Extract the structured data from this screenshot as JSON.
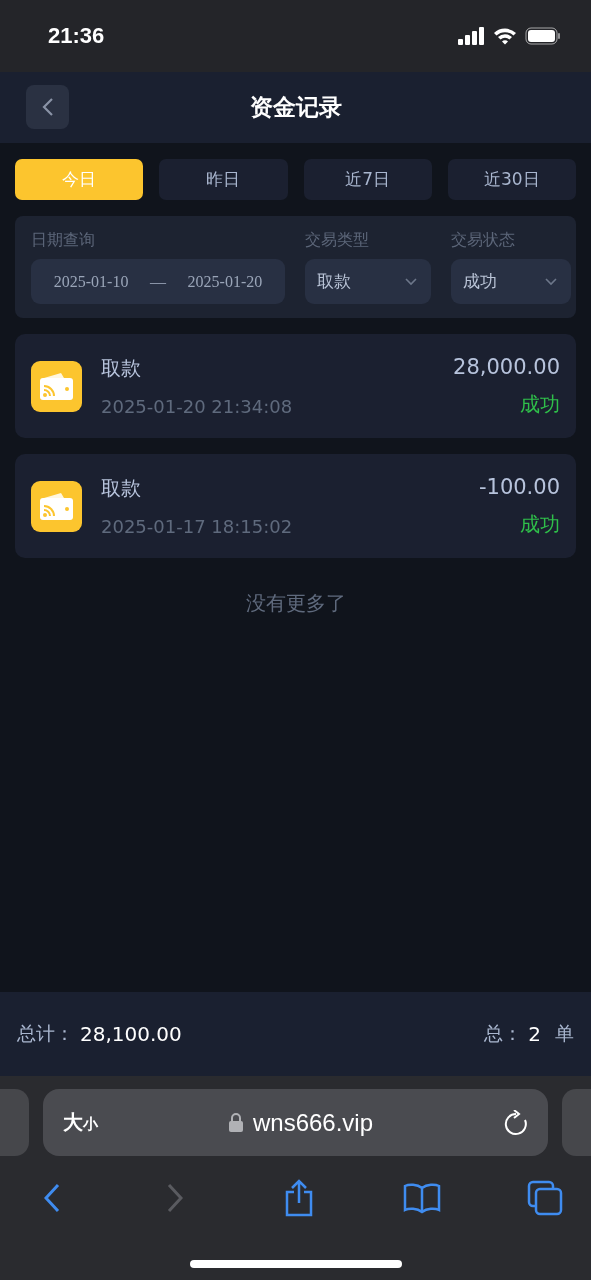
{
  "status_bar": {
    "time": "21:36"
  },
  "header": {
    "title": "资金记录"
  },
  "tabs": [
    {
      "label": "今日",
      "selected": true
    },
    {
      "label": "昨日",
      "selected": false
    },
    {
      "label": "近7日",
      "selected": false
    },
    {
      "label": "近30日",
      "selected": false
    }
  ],
  "filters": {
    "date": {
      "label": "日期查询",
      "start": "2025-01-10",
      "separator": "—",
      "end": "2025-01-20"
    },
    "type": {
      "label": "交易类型",
      "value": "取款"
    },
    "status": {
      "label": "交易状态",
      "value": "成功"
    }
  },
  "records": [
    {
      "title": "取款",
      "time": "2025-01-20 21:34:08",
      "amount": "28,000.00",
      "status": "成功",
      "color": "#2fbf4a"
    },
    {
      "title": "取款",
      "time": "2025-01-17 18:15:02",
      "amount": "-100.00",
      "status": "成功",
      "color": "#2fbf4a"
    }
  ],
  "end_note": "没有更多了",
  "summary": {
    "total_label": "总计：",
    "total": "28,100.00",
    "count_label": "总：",
    "count": "2",
    "count_unit": "单"
  },
  "browser": {
    "text_size": {
      "large": "大",
      "small": "小"
    },
    "url": "wns666.vip",
    "back_disabled": false,
    "forward_disabled": true
  }
}
